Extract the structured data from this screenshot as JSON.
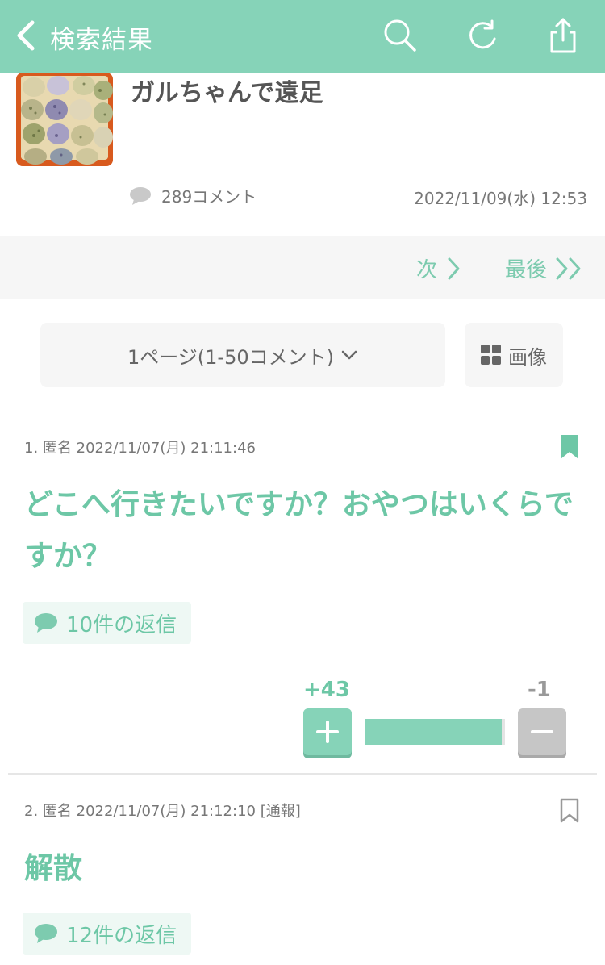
{
  "header": {
    "title": "検索結果",
    "accent": "#86d3b8"
  },
  "topic": {
    "title": "ガルちゃんで遠足",
    "comment_count": "289コメント",
    "date": "2022/11/09(水) 12:53"
  },
  "pager": {
    "next": "次",
    "last": "最後"
  },
  "page_select": {
    "label": "1ページ(1-50コメント)"
  },
  "image_button": {
    "label": "画像"
  },
  "comments": [
    {
      "meta": "1. 匿名 2022/11/07(月) 21:11:46",
      "report": "",
      "body": "どこへ行きたいですか？おやつはいくらですか？",
      "replies": "10件の返信",
      "plus": "+43",
      "minus": "-1",
      "plus_ratio": 0.977,
      "bookmarked": true
    },
    {
      "meta": "2. 匿名 2022/11/07(月) 21:12:10",
      "report": "[通報]",
      "body": "解散",
      "replies": "12件の返信",
      "bookmarked": false
    }
  ]
}
